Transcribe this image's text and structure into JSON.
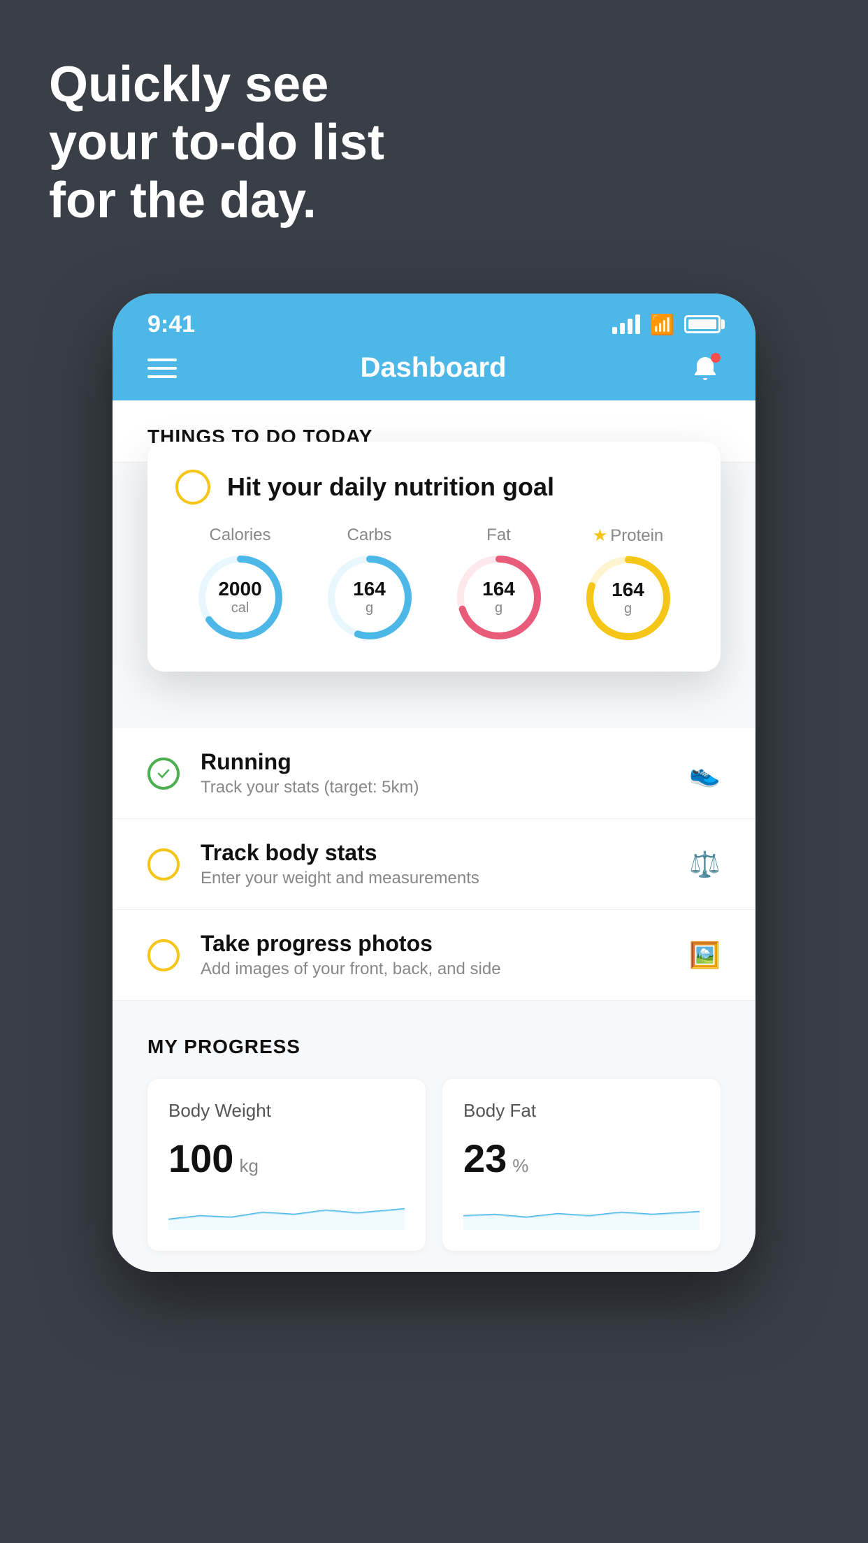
{
  "headline": {
    "line1": "Quickly see",
    "line2": "your to-do list",
    "line3": "for the day."
  },
  "status_bar": {
    "time": "9:41"
  },
  "nav": {
    "title": "Dashboard"
  },
  "section": {
    "things_title": "THINGS TO DO TODAY"
  },
  "nutrition_card": {
    "title": "Hit your daily nutrition goal",
    "items": [
      {
        "label": "Calories",
        "value": "2000",
        "unit": "cal",
        "color": "#4db8e8",
        "percent": 65
      },
      {
        "label": "Carbs",
        "value": "164",
        "unit": "g",
        "color": "#4db8e8",
        "percent": 55
      },
      {
        "label": "Fat",
        "value": "164",
        "unit": "g",
        "color": "#e85c7a",
        "percent": 70
      },
      {
        "label": "Protein",
        "value": "164",
        "unit": "g",
        "color": "#f5c518",
        "percent": 80,
        "star": true
      }
    ]
  },
  "todo_items": [
    {
      "type": "green",
      "title": "Running",
      "subtitle": "Track your stats (target: 5km)",
      "icon": "shoe"
    },
    {
      "type": "yellow",
      "title": "Track body stats",
      "subtitle": "Enter your weight and measurements",
      "icon": "scale"
    },
    {
      "type": "yellow",
      "title": "Take progress photos",
      "subtitle": "Add images of your front, back, and side",
      "icon": "photo"
    }
  ],
  "progress": {
    "title": "MY PROGRESS",
    "cards": [
      {
        "title": "Body Weight",
        "value": "100",
        "unit": "kg"
      },
      {
        "title": "Body Fat",
        "value": "23",
        "unit": "%"
      }
    ]
  }
}
